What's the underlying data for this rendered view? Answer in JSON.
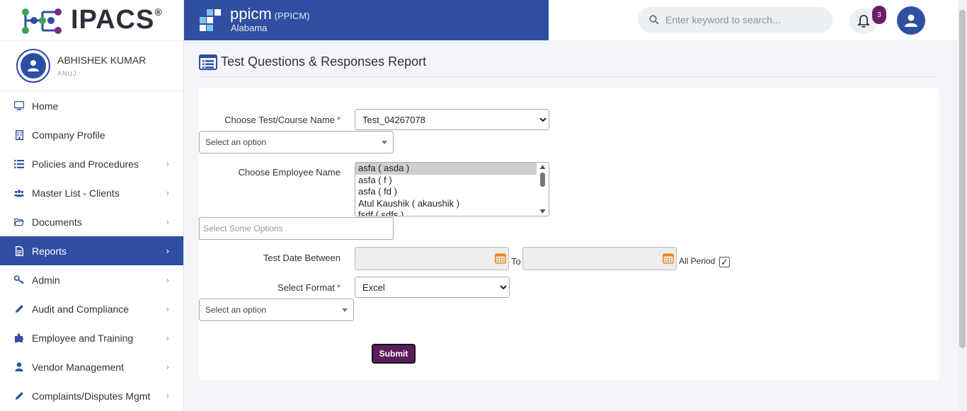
{
  "app": {
    "logo_text": "IPACS",
    "logo_reg": "®"
  },
  "brand": {
    "name": "ppicm",
    "code": "(PPICM)",
    "state": "Alabama"
  },
  "user": {
    "name": "ABHISHEK KUMAR",
    "sub": "ANUJ"
  },
  "search": {
    "placeholder": "Enter keyword to search..."
  },
  "notifications": {
    "count": "3"
  },
  "sidebar": {
    "items": [
      {
        "label": "Home",
        "icon": "monitor-icon",
        "has_chevron": false
      },
      {
        "label": "Company Profile",
        "icon": "building-icon",
        "has_chevron": false
      },
      {
        "label": "Policies and Procedures",
        "icon": "list-icon",
        "has_chevron": true
      },
      {
        "label": "Master List - Clients",
        "icon": "users-icon",
        "has_chevron": true
      },
      {
        "label": "Documents",
        "icon": "folder-open-icon",
        "has_chevron": true
      },
      {
        "label": "Reports",
        "icon": "file-text-icon",
        "has_chevron": true,
        "active": true
      },
      {
        "label": "Admin",
        "icon": "key-icon",
        "has_chevron": true
      },
      {
        "label": "Audit and Compliance",
        "icon": "pencil-icon",
        "has_chevron": true
      },
      {
        "label": "Employee and Training",
        "icon": "puzzle-icon",
        "has_chevron": true
      },
      {
        "label": "Vendor Management",
        "icon": "user-icon",
        "has_chevron": true
      },
      {
        "label": "Complaints/Disputes Mgmt",
        "icon": "pencil-icon",
        "has_chevron": true
      }
    ],
    "chevron": "›"
  },
  "page": {
    "title": "Test Questions & Responses Report"
  },
  "form": {
    "course_label": "Choose Test/Course Name",
    "course_value": "Test_04267078",
    "course_chosen_placeholder": "Select an option",
    "employee_label": "Choose Employee Name",
    "employees": [
      "asfa ( asda )",
      "asfa ( f )",
      "asfa ( fd )",
      "Atul Kaushik ( akaushik )",
      "fsdf ( sdfs )"
    ],
    "employee_chosen_placeholder": "Select Some Options",
    "date_label": "Test Date Between",
    "to_label": "To",
    "all_period_label": "All Period",
    "all_period_checked": "✓",
    "format_label": "Select Format",
    "format_value": "Excel",
    "format_chosen_placeholder": "Select an option",
    "required_mark": "*",
    "submit_label": "Submit"
  },
  "colors": {
    "primary": "#2f4fa3",
    "badge": "#6b1f6b",
    "submit": "#5b1c5e",
    "required": "#d0302f",
    "calendar": "#e8891c"
  }
}
